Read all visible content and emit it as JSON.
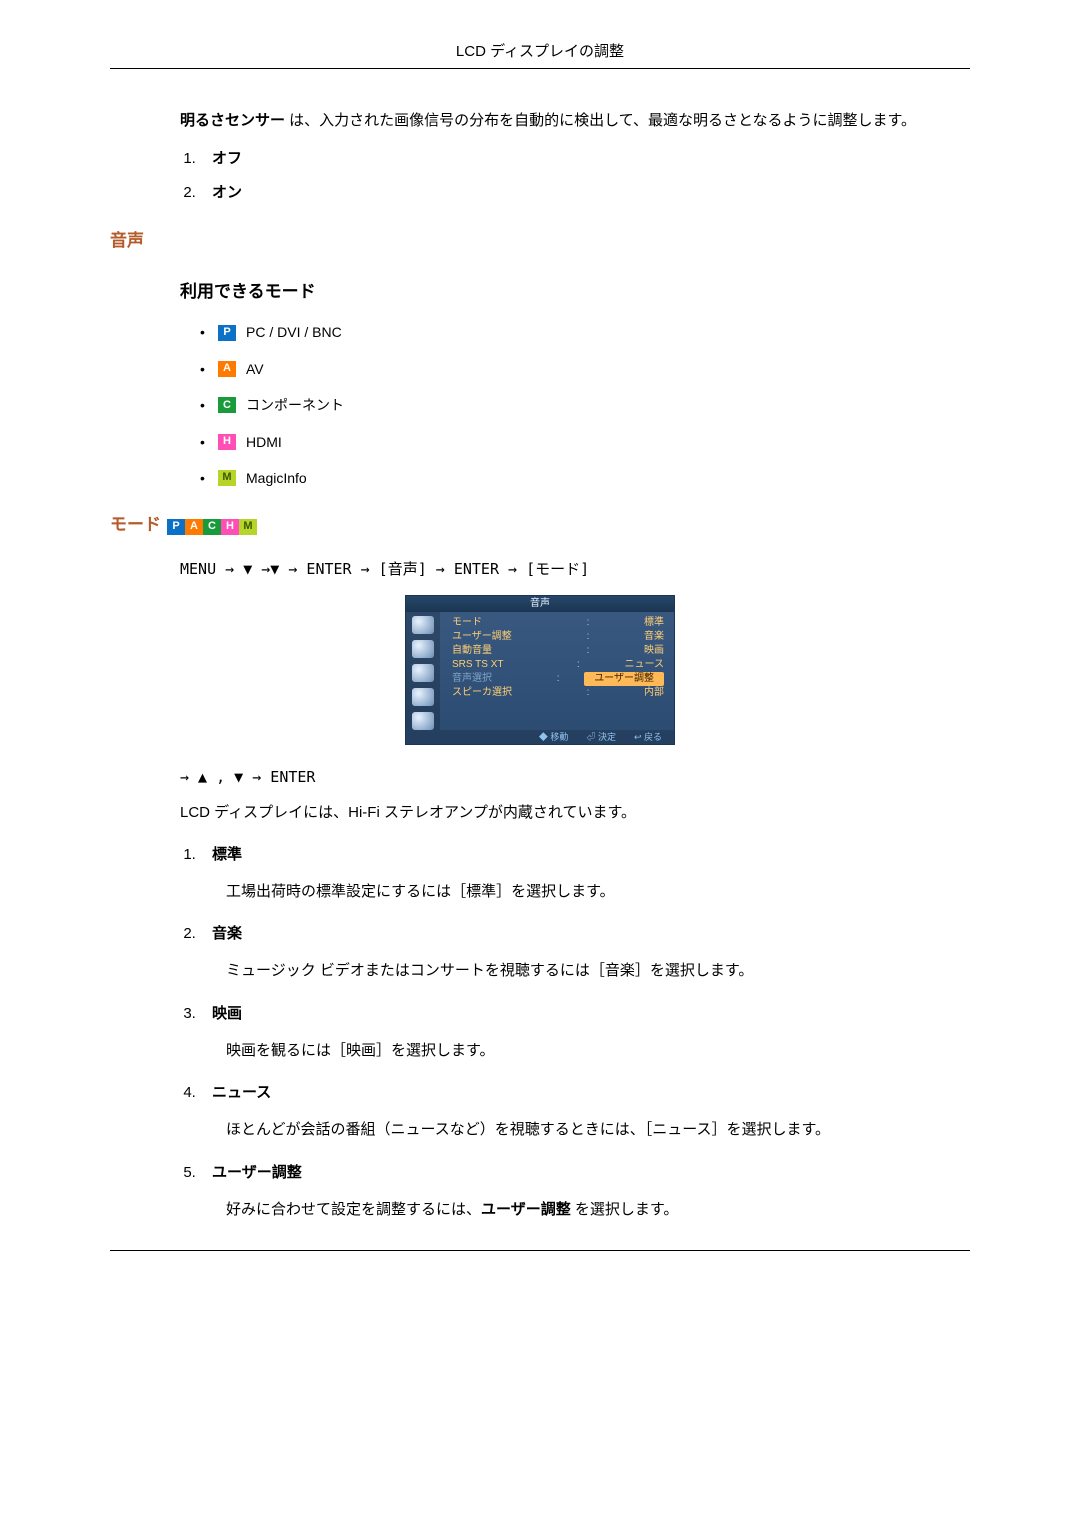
{
  "header": {
    "title": "LCD ディスプレイの調整"
  },
  "intro": {
    "sensor_label": "明るさセンサー",
    "sensor_text": " は、入力された画像信号の分布を自動的に検出して、最適な明るさとなるように調整します。",
    "opt1": "オフ",
    "opt2": "オン"
  },
  "sec_audio": {
    "title": "音声",
    "avail_title": "利用できるモード",
    "items": [
      {
        "badge": "P",
        "cls": "bP",
        "label": "PC / DVI / BNC"
      },
      {
        "badge": "A",
        "cls": "bA",
        "label": "AV"
      },
      {
        "badge": "C",
        "cls": "bC",
        "label": "コンポーネント"
      },
      {
        "badge": "H",
        "cls": "bH",
        "label": "HDMI"
      },
      {
        "badge": "M",
        "cls": "bM",
        "label": "MagicInfo"
      }
    ]
  },
  "sec_mode": {
    "title": "モード",
    "badges": [
      "P",
      "A",
      "C",
      "H",
      "M"
    ],
    "nav1": "MENU → ▼ →▼ → ENTER → [音声] → ENTER → [モード]",
    "nav2": "→ ▲ ,  ▼ → ENTER",
    "lead": "LCD ディスプレイには、Hi-Fi ステレオアンプが内蔵されています。"
  },
  "osd": {
    "title": "音声",
    "rows": [
      {
        "k": "モード",
        "v": "標準",
        "hl": false
      },
      {
        "k": "ユーザー調整",
        "v": "音楽",
        "hl": false
      },
      {
        "k": "自動音量",
        "v": "映画",
        "hl": false
      },
      {
        "k": "SRS TS XT",
        "v": "ニュース",
        "hl": false
      },
      {
        "k": "音声選択",
        "v": "ユーザー調整",
        "hl": true,
        "dim": true
      },
      {
        "k": "スピーカ選択",
        "v": "内部",
        "hl": false
      }
    ],
    "foot": {
      "a": "◆ 移動",
      "b": "⏎ 決定",
      "c": "↩ 戻る"
    }
  },
  "modes": [
    {
      "name": "標準",
      "desc": "工場出荷時の標準設定にするには［標準］を選択します。"
    },
    {
      "name": "音楽",
      "desc": "ミュージック ビデオまたはコンサートを視聴するには［音楽］を選択します。"
    },
    {
      "name": "映画",
      "desc": "映画を観るには［映画］を選択します。"
    },
    {
      "name": "ニュース",
      "desc": "ほとんどが会話の番組（ニュースなど）を視聴するときには、［ニュース］を選択します。"
    },
    {
      "name": "ユーザー調整",
      "desc_prefix": "好みに合わせて設定を調整するには、",
      "desc_bold": "ユーザー調整",
      "desc_suffix": " を選択します。"
    }
  ]
}
